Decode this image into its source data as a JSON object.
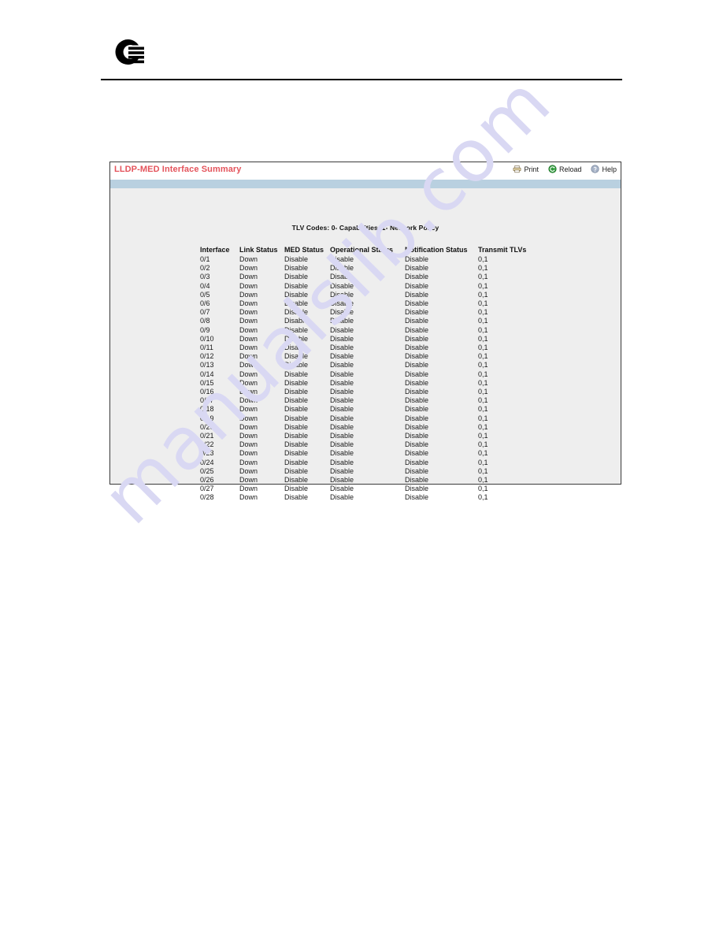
{
  "document": {
    "logo_icon": "c-ring-bars-logo",
    "header_rule": true
  },
  "panel": {
    "title": "LLDP-MED Interface Summary",
    "toolbar": [
      {
        "label": "Print",
        "icon": "printer-icon"
      },
      {
        "label": "Reload",
        "icon": "reload-icon"
      },
      {
        "label": "Help",
        "icon": "help-icon"
      }
    ],
    "note": "TLV Codes: 0- Capabilities, 1- Network Policy",
    "colors": {
      "title_text": "#e4545c",
      "accent_bar": "#b9d0e0",
      "body_background": "#eeeeee",
      "border": "#3a3a3a",
      "watermark": "#d9d8f3"
    }
  },
  "table": {
    "columns": [
      "Interface",
      "Link Status",
      "MED Status",
      "Operational Status",
      "Notification Status",
      "Transmit TLVs"
    ],
    "rows": [
      [
        "0/1",
        "Down",
        "Disable",
        "Disable",
        "Disable",
        "0,1"
      ],
      [
        "0/2",
        "Down",
        "Disable",
        "Disable",
        "Disable",
        "0,1"
      ],
      [
        "0/3",
        "Down",
        "Disable",
        "Disable",
        "Disable",
        "0,1"
      ],
      [
        "0/4",
        "Down",
        "Disable",
        "Disable",
        "Disable",
        "0,1"
      ],
      [
        "0/5",
        "Down",
        "Disable",
        "Disable",
        "Disable",
        "0,1"
      ],
      [
        "0/6",
        "Down",
        "Disable",
        "Disable",
        "Disable",
        "0,1"
      ],
      [
        "0/7",
        "Down",
        "Disable",
        "Disable",
        "Disable",
        "0,1"
      ],
      [
        "0/8",
        "Down",
        "Disable",
        "Disable",
        "Disable",
        "0,1"
      ],
      [
        "0/9",
        "Down",
        "Disable",
        "Disable",
        "Disable",
        "0,1"
      ],
      [
        "0/10",
        "Down",
        "Disable",
        "Disable",
        "Disable",
        "0,1"
      ],
      [
        "0/11",
        "Down",
        "Disable",
        "Disable",
        "Disable",
        "0,1"
      ],
      [
        "0/12",
        "Down",
        "Disable",
        "Disable",
        "Disable",
        "0,1"
      ],
      [
        "0/13",
        "Down",
        "Disable",
        "Disable",
        "Disable",
        "0,1"
      ],
      [
        "0/14",
        "Down",
        "Disable",
        "Disable",
        "Disable",
        "0,1"
      ],
      [
        "0/15",
        "Down",
        "Disable",
        "Disable",
        "Disable",
        "0,1"
      ],
      [
        "0/16",
        "Down",
        "Disable",
        "Disable",
        "Disable",
        "0,1"
      ],
      [
        "0/17",
        "Down",
        "Disable",
        "Disable",
        "Disable",
        "0,1"
      ],
      [
        "0/18",
        "Down",
        "Disable",
        "Disable",
        "Disable",
        "0,1"
      ],
      [
        "0/19",
        "Down",
        "Disable",
        "Disable",
        "Disable",
        "0,1"
      ],
      [
        "0/20",
        "Down",
        "Disable",
        "Disable",
        "Disable",
        "0,1"
      ],
      [
        "0/21",
        "Down",
        "Disable",
        "Disable",
        "Disable",
        "0,1"
      ],
      [
        "0/22",
        "Down",
        "Disable",
        "Disable",
        "Disable",
        "0,1"
      ],
      [
        "0/23",
        "Down",
        "Disable",
        "Disable",
        "Disable",
        "0,1"
      ],
      [
        "0/24",
        "Down",
        "Disable",
        "Disable",
        "Disable",
        "0,1"
      ],
      [
        "0/25",
        "Down",
        "Disable",
        "Disable",
        "Disable",
        "0,1"
      ],
      [
        "0/26",
        "Down",
        "Disable",
        "Disable",
        "Disable",
        "0,1"
      ],
      [
        "0/27",
        "Down",
        "Disable",
        "Disable",
        "Disable",
        "0,1"
      ],
      [
        "0/28",
        "Down",
        "Disable",
        "Disable",
        "Disable",
        "0,1"
      ]
    ]
  },
  "watermark": {
    "text": "manualslib.com"
  }
}
